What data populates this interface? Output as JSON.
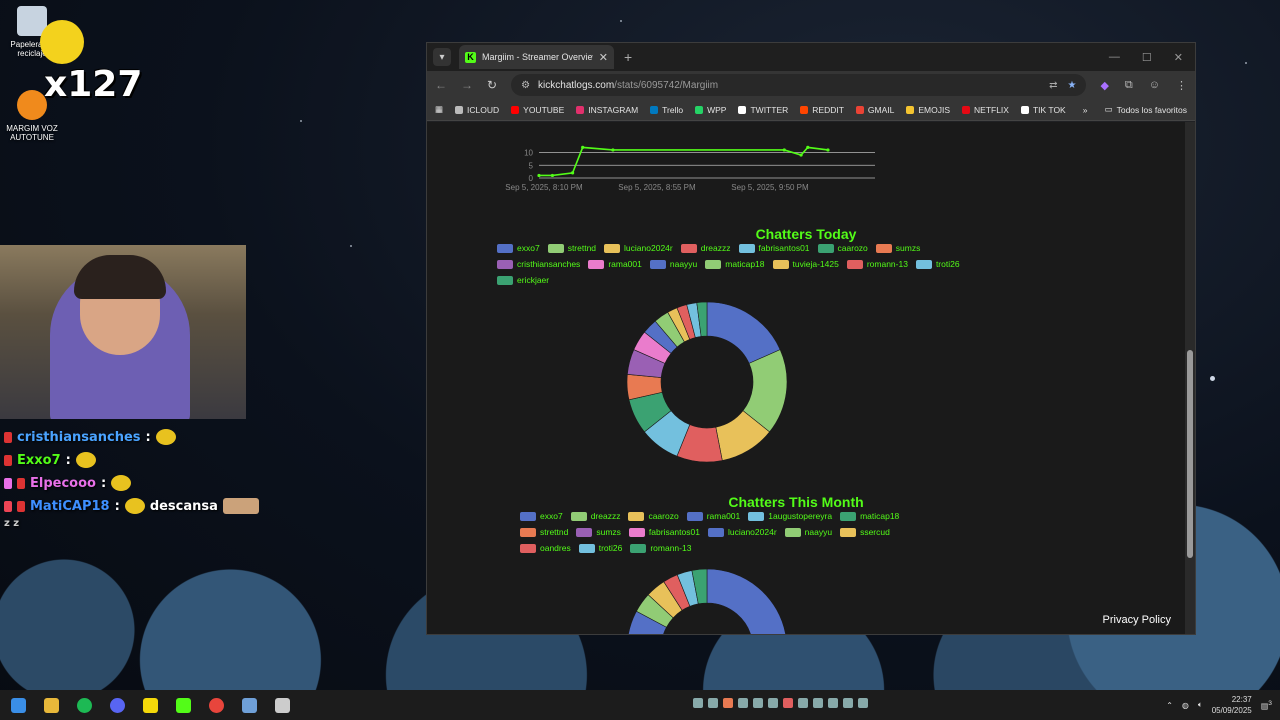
{
  "desktop": {
    "icons": [
      {
        "label": "Papelera de reciclaje",
        "icon": "recycle-bin-icon"
      },
      {
        "label": "MARGIM VOZ AUTOTUNE",
        "icon": "fl-studio-icon"
      }
    ],
    "emote_counter": "x127"
  },
  "chat": {
    "lines": [
      {
        "user": "cristhiansanches",
        "color": "#4aa3ff",
        "message": ""
      },
      {
        "user": "Exxo7",
        "color": "#53fc18",
        "message": ""
      },
      {
        "user": "Elpecooo",
        "color": "#e870e8",
        "message": ""
      },
      {
        "user": "MatiCAP18",
        "color": "#3e8fff",
        "message": "descansa"
      }
    ],
    "extra": "z z"
  },
  "browser": {
    "tab_title": "Margiim - Streamer Overview &",
    "tab_favicon": "K",
    "url_host": "kickchatlogs.com",
    "url_path": "/stats/6095742/Margiim",
    "bookmarks": [
      {
        "label": "ICLOUD",
        "color": "#bbbbbb"
      },
      {
        "label": "YOUTUBE",
        "color": "#ff0000"
      },
      {
        "label": "INSTAGRAM",
        "color": "#e1306c"
      },
      {
        "label": "Trello",
        "color": "#0079bf"
      },
      {
        "label": "WPP",
        "color": "#25d366"
      },
      {
        "label": "TWITTER",
        "color": "#ffffff"
      },
      {
        "label": "REDDIT",
        "color": "#ff4500"
      },
      {
        "label": "GMAIL",
        "color": "#ea4335"
      },
      {
        "label": "EMOJIS",
        "color": "#f4c430"
      },
      {
        "label": "NETFLIX",
        "color": "#e50914"
      },
      {
        "label": "TIK TOK",
        "color": "#ffffff"
      }
    ],
    "all_bookmarks": "Todos los favoritos",
    "privacy": "Privacy Policy"
  },
  "chart_data": [
    {
      "type": "line",
      "x": [
        "Sep 5, 2025, 8:10 PM",
        "Sep 5, 2025, 8:55 PM",
        "Sep 5, 2025, 9:50 PM"
      ],
      "y_ticks": [
        0,
        5,
        10
      ],
      "points": [
        [
          0.0,
          1
        ],
        [
          0.04,
          1
        ],
        [
          0.1,
          2
        ],
        [
          0.13,
          12
        ],
        [
          0.22,
          11
        ],
        [
          0.73,
          11
        ],
        [
          0.78,
          9
        ],
        [
          0.8,
          12
        ],
        [
          0.86,
          11
        ]
      ],
      "accent": "#53fc18"
    },
    {
      "type": "pie",
      "title": "Chatters Today",
      "labels": [
        "exxo7",
        "strettnd",
        "luciano2024r",
        "dreazzz",
        "fabrisantos01",
        "caarozo",
        "sumzs",
        "cristhiansanches",
        "rama001",
        "naayyu",
        "maticap18",
        "tuvieja-1425",
        "romann-13",
        "troti26",
        "erickjaer"
      ],
      "values": [
        18,
        17,
        11,
        9,
        8,
        7,
        5,
        5,
        4,
        3,
        3,
        2,
        2,
        2,
        2
      ],
      "colors": [
        "#5470c6",
        "#91cc75",
        "#e8c15a",
        "#e05f5f",
        "#73c0de",
        "#3ba272",
        "#e87a52",
        "#9a60b4",
        "#ea7ccc",
        "#5470c6",
        "#91cc75",
        "#e8c15a",
        "#e05f5f",
        "#73c0de",
        "#3ba272"
      ]
    },
    {
      "type": "pie",
      "title": "Chatters This Month",
      "labels": [
        "exxo7",
        "dreazzz",
        "caarozo",
        "rama001",
        "1augustopereyra",
        "maticap18",
        "strettnd",
        "sumzs",
        "fabrisantos01",
        "luciano2024r",
        "naayyu",
        "ssercud",
        "oandres",
        "troti26",
        "romann-13"
      ],
      "values": [
        22,
        13,
        8,
        7,
        6,
        6,
        5,
        5,
        5,
        5,
        4,
        4,
        3,
        3,
        3
      ],
      "colors": [
        "#5470c6",
        "#91cc75",
        "#e8c15a",
        "#5470c6",
        "#73c0de",
        "#3ba272",
        "#e87a52",
        "#9a60b4",
        "#ea7ccc",
        "#5470c6",
        "#91cc75",
        "#e8c15a",
        "#e05f5f",
        "#73c0de",
        "#3ba272"
      ]
    }
  ],
  "taskbar": {
    "apps": [
      "windows-start-icon",
      "file-explorer-icon",
      "spotify-icon",
      "discord-icon",
      "sticky-notes-icon",
      "kick-icon",
      "chrome-icon",
      "davinci-icon",
      "obs-icon"
    ],
    "app_colors": [
      "#3a8ee6",
      "#e8b83a",
      "#1db954",
      "#5865f2",
      "#f5d90a",
      "#53fc18",
      "#e8453c",
      "#6fa0d8",
      "#cccccc"
    ],
    "time": "22:37",
    "date": "05/09/2025",
    "notification_count": "3"
  }
}
